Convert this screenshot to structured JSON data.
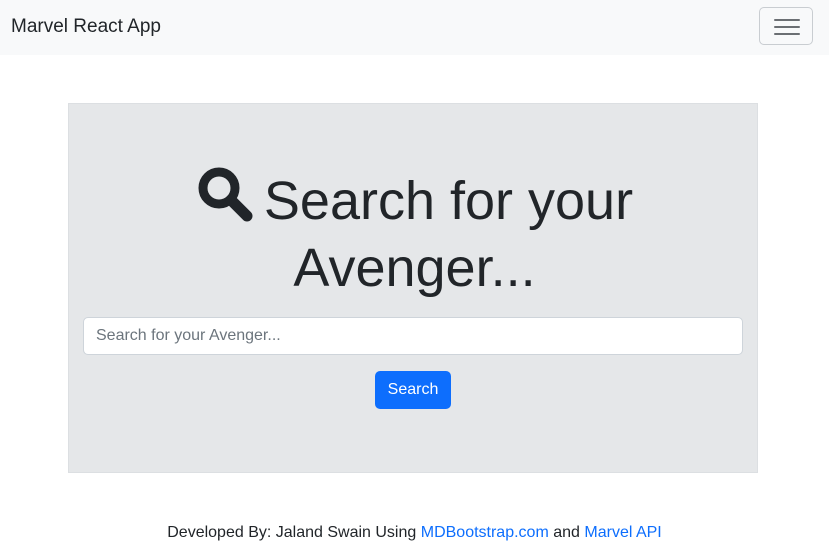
{
  "navbar": {
    "brand": "Marvel React App",
    "toggler_icon": "hamburger-menu-icon"
  },
  "hero": {
    "icon": "search-icon",
    "heading_line1": "Search for your",
    "heading_line2": "Avenger...",
    "background_color": "#e5e7e9"
  },
  "search": {
    "value": "",
    "placeholder": "Search for your Avenger...",
    "button_label": "Search",
    "button_color": "#0d6efd"
  },
  "footer": {
    "prefix": "Developed By: Jaland Swain Using",
    "link1": "MDBootstrap.com",
    "conjunction": "and",
    "link2": "Marvel API",
    "link_color": "#0d6efd"
  }
}
